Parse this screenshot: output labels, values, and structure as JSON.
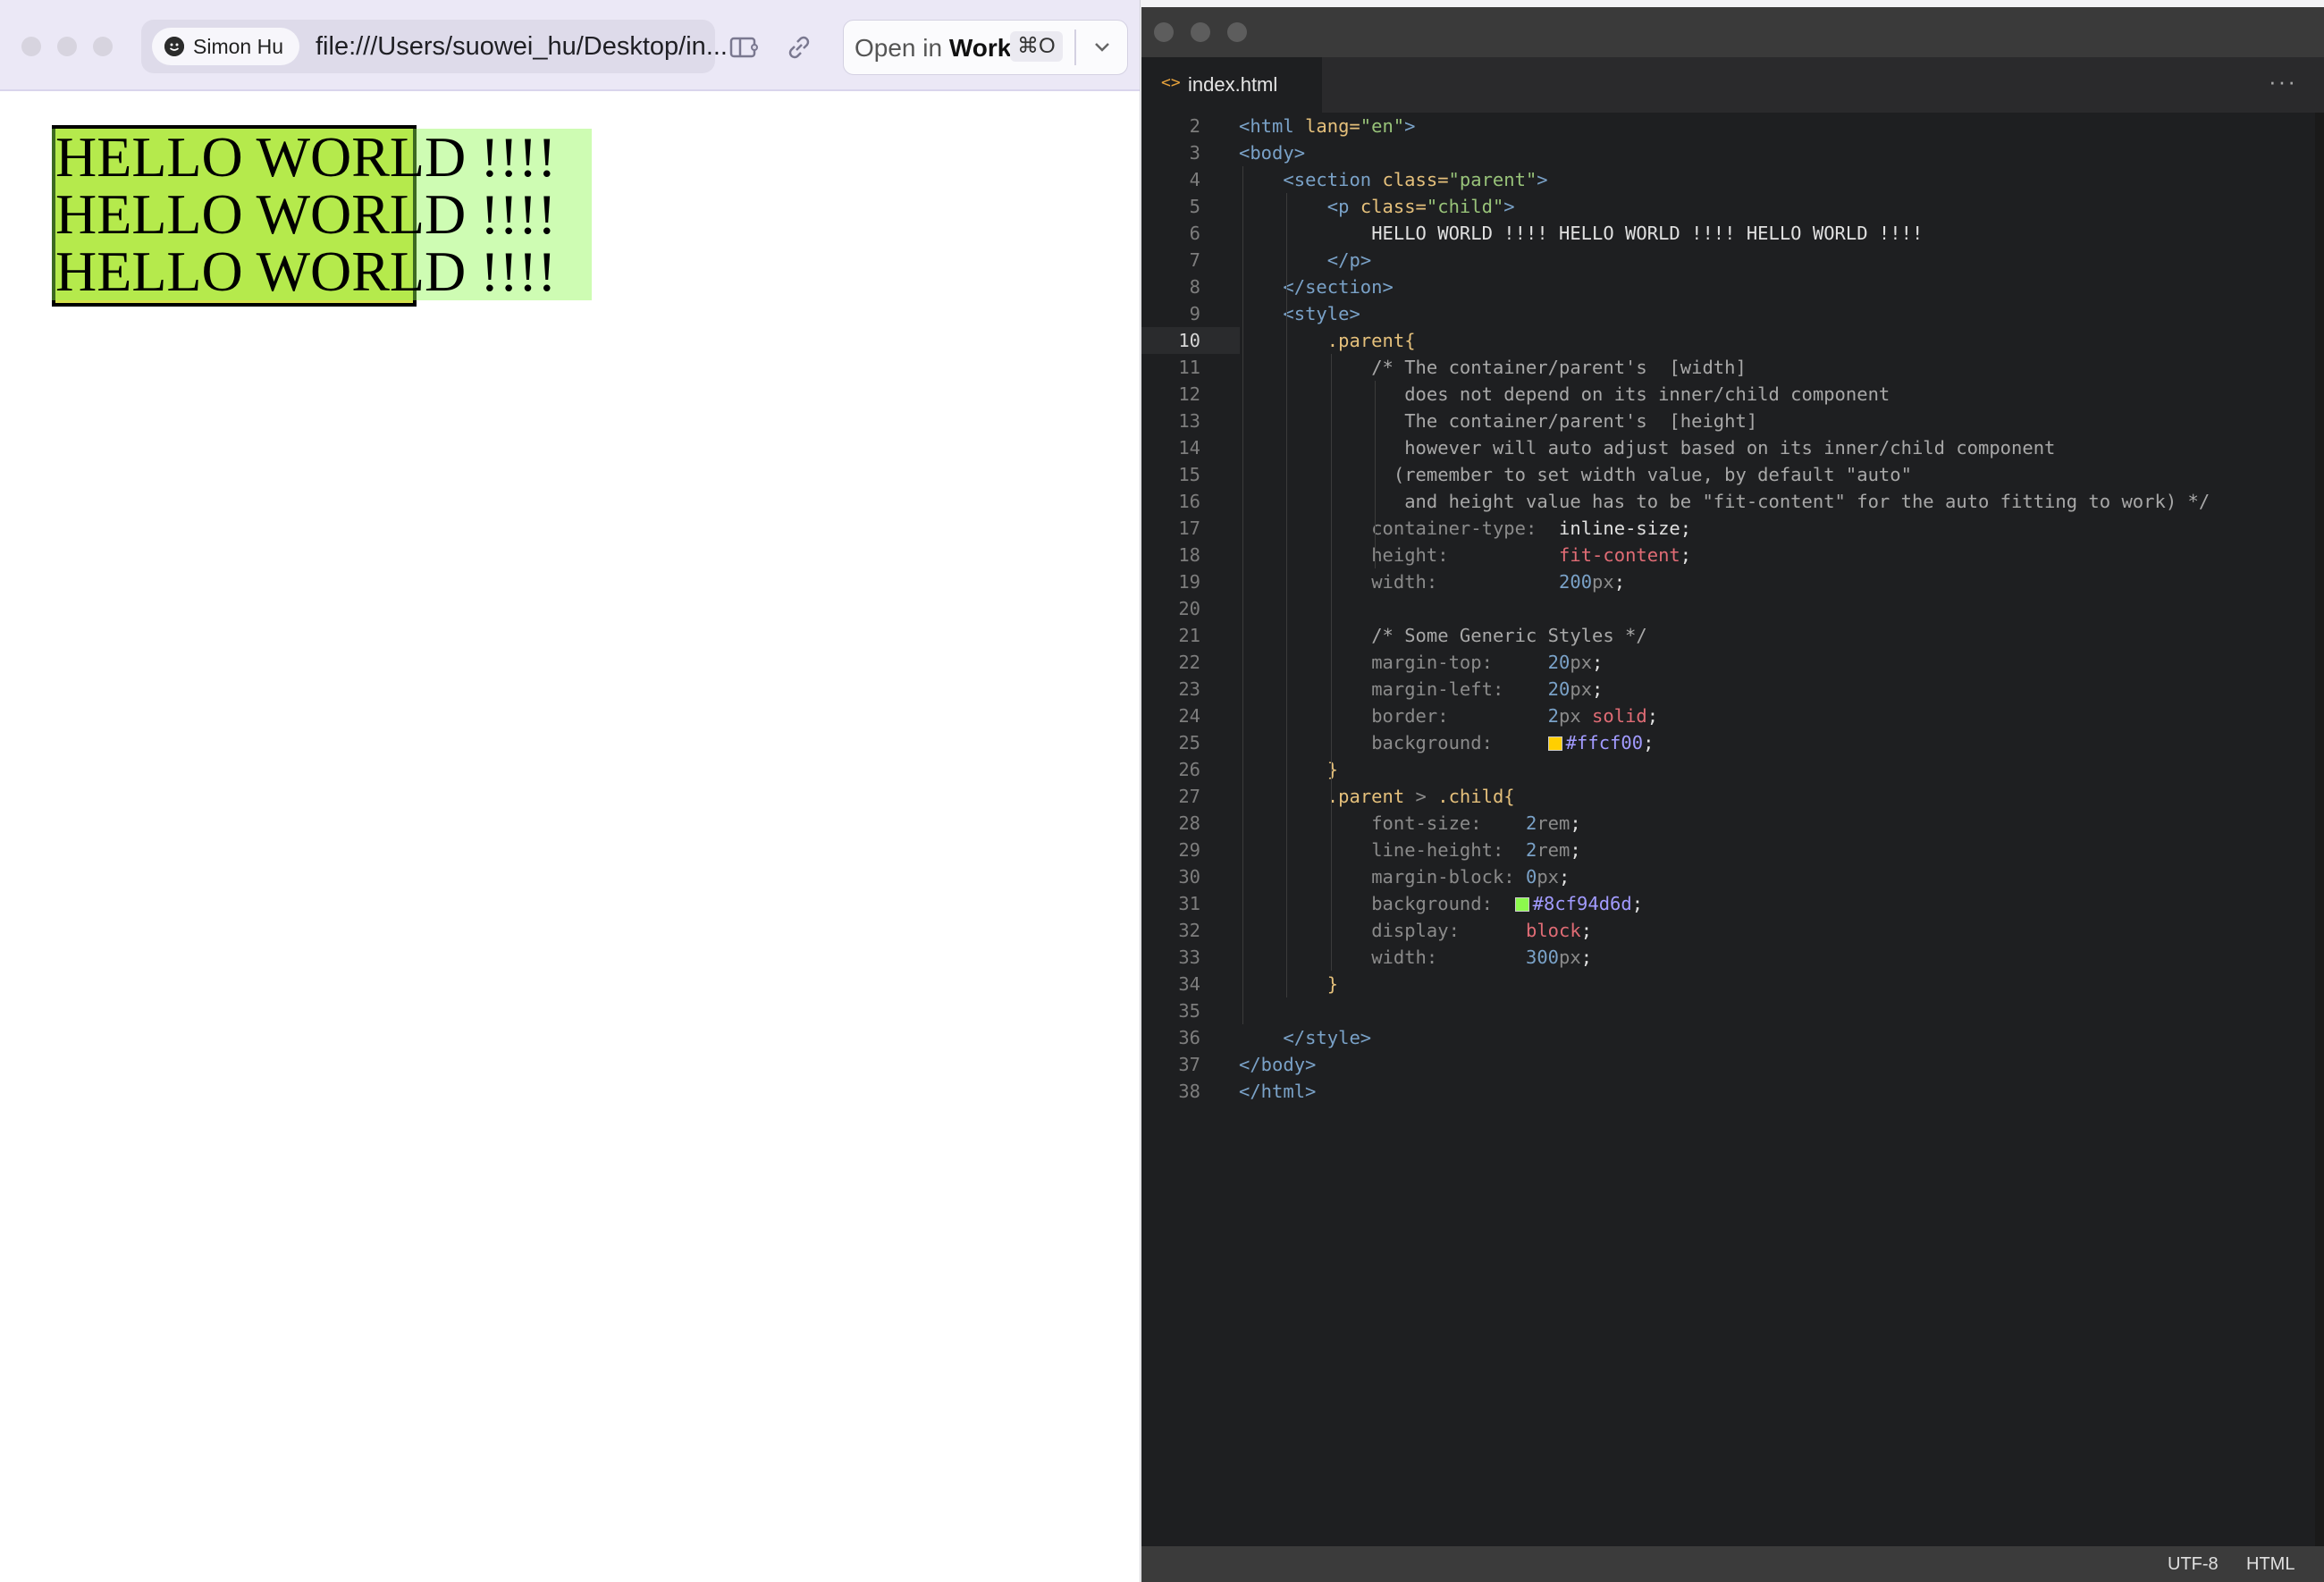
{
  "browser": {
    "profile_name": "Simon Hu",
    "url": "file:///Users/suowei_hu/Desktop/in...",
    "open_in": {
      "prefix": "Open in ",
      "target": "Work",
      "shortcut": "⌘O"
    },
    "page": {
      "lines": [
        "HELLO WORLD !!!!",
        "HELLO WORLD !!!!",
        "HELLO WORLD !!!!"
      ],
      "parent_background": "#d4e04c",
      "child_background": "#8cf94d6d"
    }
  },
  "editor": {
    "tab_name": "index.html",
    "active_line": 10,
    "status": {
      "encoding": "UTF-8",
      "language": "HTML"
    },
    "lines": [
      {
        "n": "2",
        "indent": 0,
        "t": [
          [
            "tag",
            "<html "
          ],
          [
            "attr",
            "lang="
          ],
          [
            "str",
            "\"en\""
          ],
          [
            "tag",
            ">"
          ]
        ]
      },
      {
        "n": "3",
        "indent": 0,
        "t": [
          [
            "tag",
            "<body>"
          ]
        ]
      },
      {
        "n": "4",
        "indent": 4,
        "t": [
          [
            "tag",
            "<section "
          ],
          [
            "attr",
            "class="
          ],
          [
            "str",
            "\"parent\""
          ],
          [
            "tag",
            ">"
          ]
        ]
      },
      {
        "n": "5",
        "indent": 8,
        "t": [
          [
            "tag",
            "<p "
          ],
          [
            "attr",
            "class="
          ],
          [
            "str",
            "\"child\""
          ],
          [
            "tag",
            ">"
          ]
        ]
      },
      {
        "n": "6",
        "indent": 12,
        "t": [
          [
            "val",
            "HELLO WORLD !!!! HELLO WORLD !!!! HELLO WORLD !!!!"
          ]
        ]
      },
      {
        "n": "7",
        "indent": 8,
        "t": [
          [
            "tag",
            "</p>"
          ]
        ]
      },
      {
        "n": "8",
        "indent": 4,
        "t": [
          [
            "tag",
            "</section>"
          ]
        ]
      },
      {
        "n": "9",
        "indent": 4,
        "t": [
          [
            "tag",
            "<style>"
          ]
        ]
      },
      {
        "n": "10",
        "indent": 8,
        "t": [
          [
            "sel",
            ".parent{"
          ]
        ]
      },
      {
        "n": "11",
        "indent": 12,
        "t": [
          [
            "com",
            "/* The container/parent's  [width]"
          ]
        ]
      },
      {
        "n": "12",
        "indent": 12,
        "t": [
          [
            "com",
            "   does not depend on its inner/child component"
          ]
        ]
      },
      {
        "n": "13",
        "indent": 12,
        "t": [
          [
            "com",
            "   The container/parent's  [height]"
          ]
        ]
      },
      {
        "n": "14",
        "indent": 12,
        "t": [
          [
            "com",
            "   however will auto adjust based on its inner/child component"
          ]
        ]
      },
      {
        "n": "15",
        "indent": 12,
        "t": [
          [
            "com",
            "  (remember to set width value, by default \"auto\""
          ]
        ]
      },
      {
        "n": "16",
        "indent": 12,
        "t": [
          [
            "com",
            "   and height value has to be \"fit-content\" for the auto fitting to work) */"
          ]
        ]
      },
      {
        "n": "17",
        "indent": 12,
        "t": [
          [
            "prop",
            "container-type:  "
          ],
          [
            "val",
            "inline-size"
          ],
          [
            "val",
            ";"
          ]
        ]
      },
      {
        "n": "18",
        "indent": 12,
        "t": [
          [
            "prop",
            "height:          "
          ],
          [
            "kw",
            "fit-content"
          ],
          [
            "val",
            ";"
          ]
        ]
      },
      {
        "n": "19",
        "indent": 12,
        "t": [
          [
            "prop",
            "width:           "
          ],
          [
            "num",
            "200"
          ],
          [
            "unit",
            "px"
          ],
          [
            "val",
            ";"
          ]
        ]
      },
      {
        "n": "20",
        "indent": 0,
        "t": []
      },
      {
        "n": "21",
        "indent": 12,
        "t": [
          [
            "com",
            "/* Some Generic Styles */"
          ]
        ]
      },
      {
        "n": "22",
        "indent": 12,
        "t": [
          [
            "prop",
            "margin-top:     "
          ],
          [
            "num",
            "20"
          ],
          [
            "unit",
            "px"
          ],
          [
            "val",
            ";"
          ]
        ]
      },
      {
        "n": "23",
        "indent": 12,
        "t": [
          [
            "prop",
            "margin-left:    "
          ],
          [
            "num",
            "20"
          ],
          [
            "unit",
            "px"
          ],
          [
            "val",
            ";"
          ]
        ]
      },
      {
        "n": "24",
        "indent": 12,
        "t": [
          [
            "prop",
            "border:         "
          ],
          [
            "num",
            "2"
          ],
          [
            "unit",
            "px "
          ],
          [
            "kw",
            "solid"
          ],
          [
            "val",
            ";"
          ]
        ]
      },
      {
        "n": "25",
        "indent": 12,
        "t": [
          [
            "prop",
            "background:     "
          ],
          [
            "swatch",
            "#ffcf00"
          ],
          [
            "hex",
            "#ffcf00"
          ],
          [
            "val",
            ";"
          ]
        ]
      },
      {
        "n": "26",
        "indent": 8,
        "t": [
          [
            "sel",
            "}"
          ]
        ]
      },
      {
        "n": "27",
        "indent": 8,
        "t": [
          [
            "sel",
            ".parent "
          ],
          [
            "prop",
            "> "
          ],
          [
            "sel",
            ".child{"
          ]
        ]
      },
      {
        "n": "28",
        "indent": 12,
        "t": [
          [
            "prop",
            "font-size:    "
          ],
          [
            "num",
            "2"
          ],
          [
            "unit",
            "rem"
          ],
          [
            "val",
            ";"
          ]
        ]
      },
      {
        "n": "29",
        "indent": 12,
        "t": [
          [
            "prop",
            "line-height:  "
          ],
          [
            "num",
            "2"
          ],
          [
            "unit",
            "rem"
          ],
          [
            "val",
            ";"
          ]
        ]
      },
      {
        "n": "30",
        "indent": 12,
        "t": [
          [
            "prop",
            "margin-block: "
          ],
          [
            "num",
            "0"
          ],
          [
            "unit",
            "px"
          ],
          [
            "val",
            ";"
          ]
        ]
      },
      {
        "n": "31",
        "indent": 12,
        "t": [
          [
            "prop",
            "background:  "
          ],
          [
            "swatch",
            "#8cf94d"
          ],
          [
            "hex",
            "#8cf94d6d"
          ],
          [
            "val",
            ";"
          ]
        ]
      },
      {
        "n": "32",
        "indent": 12,
        "t": [
          [
            "prop",
            "display:      "
          ],
          [
            "kw",
            "block"
          ],
          [
            "val",
            ";"
          ]
        ]
      },
      {
        "n": "33",
        "indent": 12,
        "t": [
          [
            "prop",
            "width:        "
          ],
          [
            "num",
            "300"
          ],
          [
            "unit",
            "px"
          ],
          [
            "val",
            ";"
          ]
        ]
      },
      {
        "n": "34",
        "indent": 8,
        "t": [
          [
            "sel",
            "}"
          ]
        ]
      },
      {
        "n": "35",
        "indent": 0,
        "t": []
      },
      {
        "n": "36",
        "indent": 4,
        "t": [
          [
            "tag",
            "</style>"
          ]
        ]
      },
      {
        "n": "37",
        "indent": 0,
        "t": [
          [
            "tag",
            "</body>"
          ]
        ]
      },
      {
        "n": "38",
        "indent": 0,
        "t": [
          [
            "tag",
            "</html>"
          ]
        ]
      }
    ]
  }
}
